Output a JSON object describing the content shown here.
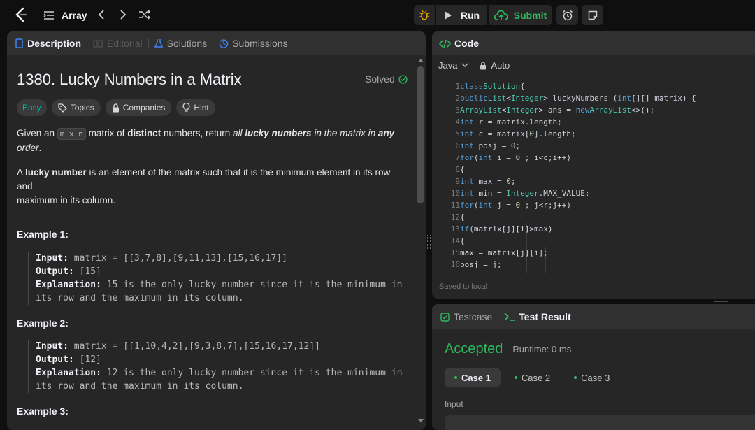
{
  "topbar": {
    "problem_list": "Array",
    "run_label": "Run",
    "submit_label": "Submit"
  },
  "left_panel": {
    "tabs": {
      "description": "Description",
      "editorial": "Editorial",
      "solutions": "Solutions",
      "submissions": "Submissions"
    },
    "title": "1380. Lucky Numbers in a Matrix",
    "status": "Solved",
    "chips": {
      "difficulty": "Easy",
      "topics": "Topics",
      "companies": "Companies",
      "hint": "Hint"
    },
    "para1": {
      "p1": "Given an ",
      "code": "m x n",
      "p2": " matrix of ",
      "b1": "distinct",
      "p3": " numbers, return ",
      "i1": "all ",
      "bi1": "lucky numbers",
      "i2": " in the matrix in ",
      "bi2": "any",
      "i3": "order",
      "p4": "."
    },
    "para2": {
      "p1": "A ",
      "b1": "lucky number",
      "p2": " is an element of the matrix such that it is the minimum element in its row and",
      "p3": "maximum in its column."
    },
    "examples": [
      {
        "heading": "Example 1:",
        "input_label": "Input:",
        "input": "matrix = [[3,7,8],[9,11,13],[15,16,17]]",
        "output_label": "Output:",
        "output": "[15]",
        "explanation_label": "Explanation:",
        "explanation1": "15 is the only lucky number since it is the minimum in",
        "explanation2": "its row and the maximum in its column."
      },
      {
        "heading": "Example 2:",
        "input_label": "Input:",
        "input": "matrix = [[1,10,4,2],[9,3,8,7],[15,16,17,12]]",
        "output_label": "Output:",
        "output": "[12]",
        "explanation_label": "Explanation:",
        "explanation1": "12 is the only lucky number since it is the minimum in",
        "explanation2": "its row and the maximum in its column."
      },
      {
        "heading": "Example 3:"
      }
    ]
  },
  "code_panel": {
    "title": "Code",
    "language": "Java",
    "mode": "Auto",
    "footer": "Saved to local",
    "line_numbers": [
      "1",
      "2",
      "3",
      "4",
      "5",
      "6",
      "7",
      "8",
      "9",
      "10",
      "11",
      "12",
      "13",
      "14",
      "15",
      "16"
    ]
  },
  "result_panel": {
    "tabs": {
      "testcase": "Testcase",
      "test_result": "Test Result"
    },
    "verdict": "Accepted",
    "runtime": "Runtime: 0 ms",
    "cases": [
      "Case 1",
      "Case 2",
      "Case 3"
    ],
    "input_label": "Input"
  },
  "colors": {
    "accent_green": "#2cbb5d",
    "easy_teal": "#00b8a3",
    "background": "#0f0f0f",
    "panel": "#262626"
  }
}
